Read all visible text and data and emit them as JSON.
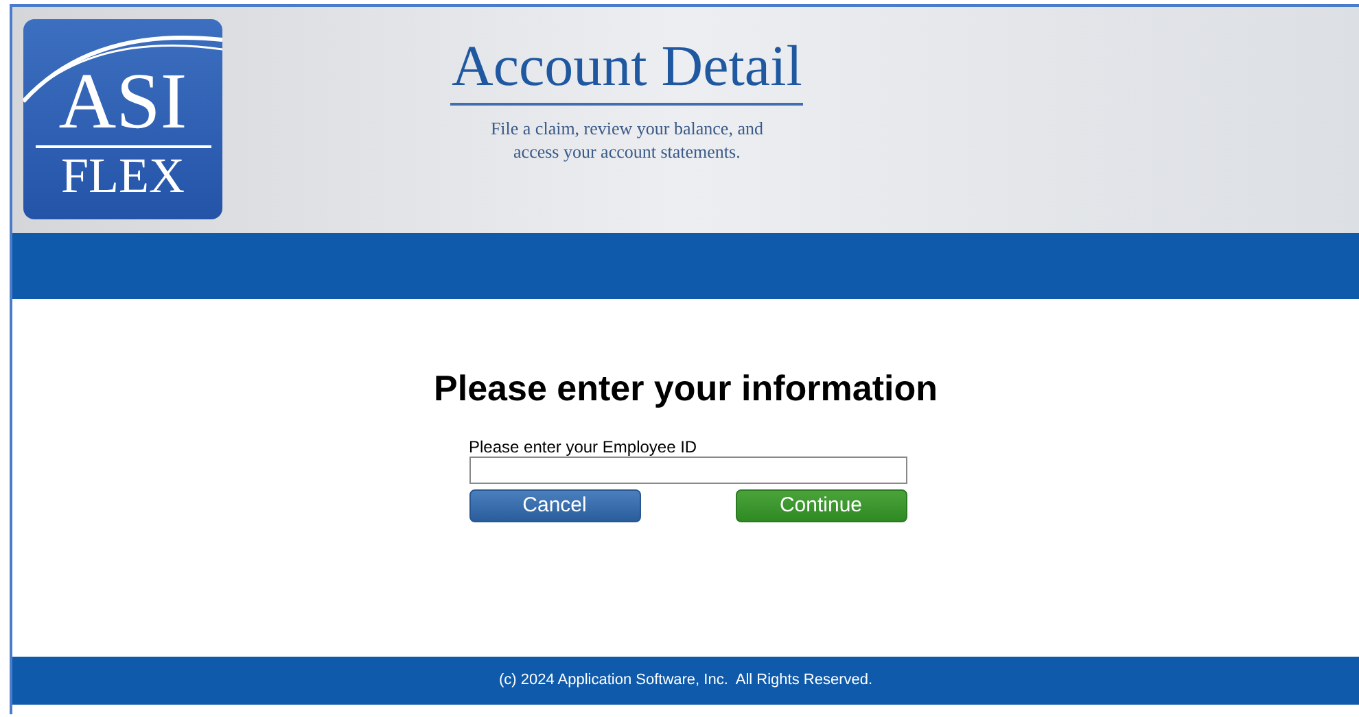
{
  "logo": {
    "line_1": "ASI",
    "line_2": "FLEX"
  },
  "header": {
    "title": "Account Detail",
    "subtitle_lines": [
      "File a claim, review your balance, and",
      "access your account statements."
    ]
  },
  "form": {
    "heading": "Please enter your information",
    "field_label": "Please enter your Employee ID",
    "buttons": [
      {
        "label": "Cancel",
        "kind": "secondary"
      },
      {
        "label": "Continue",
        "kind": "primary"
      }
    ]
  },
  "footer": {
    "text": "(c) 2024 Application Software, Inc.  All Rights Reserved."
  }
}
